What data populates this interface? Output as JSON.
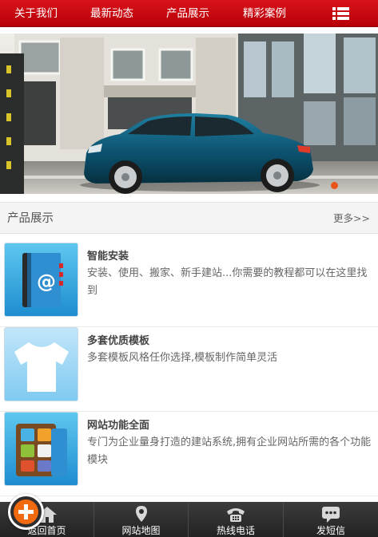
{
  "nav": {
    "items": [
      {
        "label": "关于我们"
      },
      {
        "label": "最新动态"
      },
      {
        "label": "产品展示"
      },
      {
        "label": "精彩案例"
      }
    ],
    "menu_icon": "list-menu-icon"
  },
  "banner": {
    "slides_total": 2,
    "active_index": 0,
    "active_dot_color": "#e8541a"
  },
  "section": {
    "title": "产品展示",
    "more": "更多>>"
  },
  "products": [
    {
      "title": "智能安装",
      "desc": "安装、使用、搬家、新手建站...你需要的教程都可以在这里找到",
      "icon": "address-book-at-icon"
    },
    {
      "title": "多套优质模板",
      "desc": "多套模板风格任你选择,模板制作简单灵活",
      "icon": "tshirt-icon"
    },
    {
      "title": "网站功能全面",
      "desc": "专门为企业量身打造的建站系统,拥有企业网站所需的各个功能模块",
      "icon": "app-grid-book-icon"
    }
  ],
  "bottom_bar": {
    "items": [
      {
        "label": "返回首页",
        "icon": "home-icon"
      },
      {
        "label": "网站地图",
        "icon": "map-pin-icon"
      },
      {
        "label": "热线电话",
        "icon": "telephone-icon"
      },
      {
        "label": "发短信",
        "icon": "message-bubble-icon"
      }
    ],
    "fab_icon": "plus-icon"
  },
  "colors": {
    "nav_red": "#c80a12",
    "accent_orange": "#f26a10",
    "bottom_bar": "#2b2b2b"
  }
}
